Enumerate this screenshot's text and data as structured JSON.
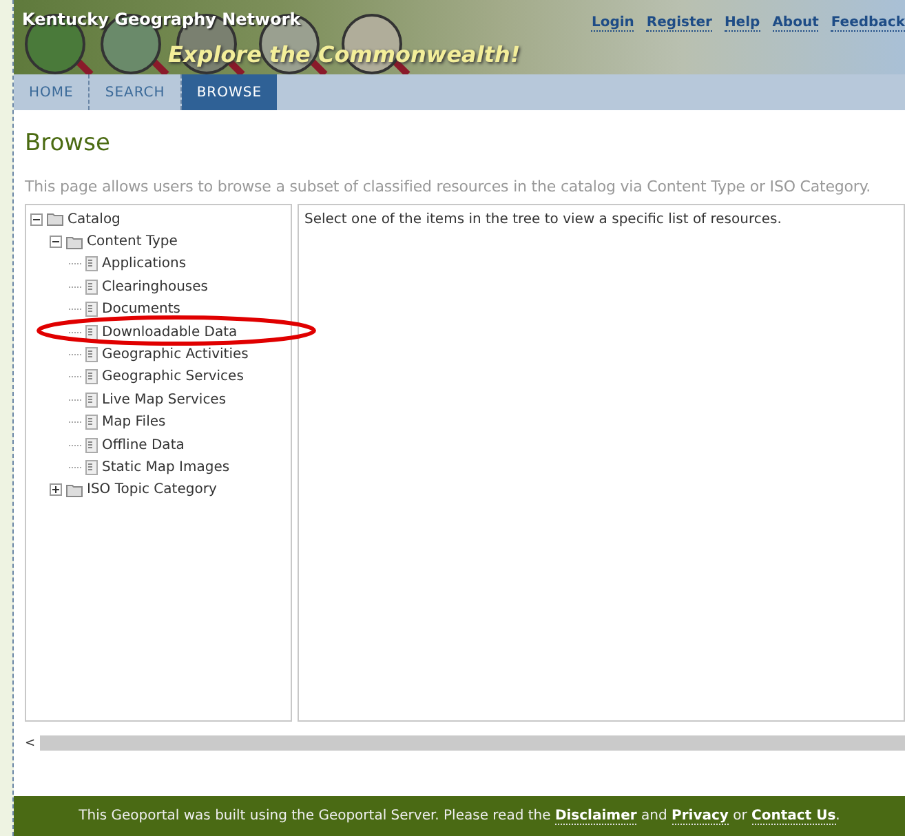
{
  "header": {
    "site_title": "Kentucky Geography Network",
    "tagline": "Explore the Commonwealth!",
    "links": [
      "Login",
      "Register",
      "Help",
      "About",
      "Feedback"
    ]
  },
  "nav": [
    {
      "label": "HOME",
      "selected": false
    },
    {
      "label": "SEARCH",
      "selected": false
    },
    {
      "label": "BROWSE",
      "selected": true
    }
  ],
  "page": {
    "title": "Browse",
    "description": "This page allows users to browse a subset of classified resources in the catalog via Content Type or ISO Category."
  },
  "tree": [
    {
      "label": "Catalog",
      "kind": "folder",
      "expanded": true,
      "children": [
        {
          "label": "Content Type",
          "kind": "folder",
          "expanded": true,
          "children": [
            {
              "label": "Applications",
              "kind": "leaf"
            },
            {
              "label": "Clearinghouses",
              "kind": "leaf"
            },
            {
              "label": "Documents",
              "kind": "leaf"
            },
            {
              "label": "Downloadable Data",
              "kind": "leaf"
            },
            {
              "label": "Geographic Activities",
              "kind": "leaf"
            },
            {
              "label": "Geographic Services",
              "kind": "leaf"
            },
            {
              "label": "Live Map Services",
              "kind": "leaf"
            },
            {
              "label": "Map Files",
              "kind": "leaf"
            },
            {
              "label": "Offline Data",
              "kind": "leaf"
            },
            {
              "label": "Static Map Images",
              "kind": "leaf"
            }
          ]
        },
        {
          "label": "ISO Topic Category",
          "kind": "folder",
          "expanded": false
        }
      ]
    }
  ],
  "results": {
    "message": "Select one of the items in the tree to view a specific list of resources."
  },
  "scrollbar": {
    "arrow": "<"
  },
  "footer": {
    "text": "This Geoportal was built using the Geoportal Server. Please read the",
    "links": [
      "Disclaimer",
      "Privacy",
      "Contact Us"
    ],
    "joiners": [
      "and",
      "or",
      "."
    ]
  }
}
